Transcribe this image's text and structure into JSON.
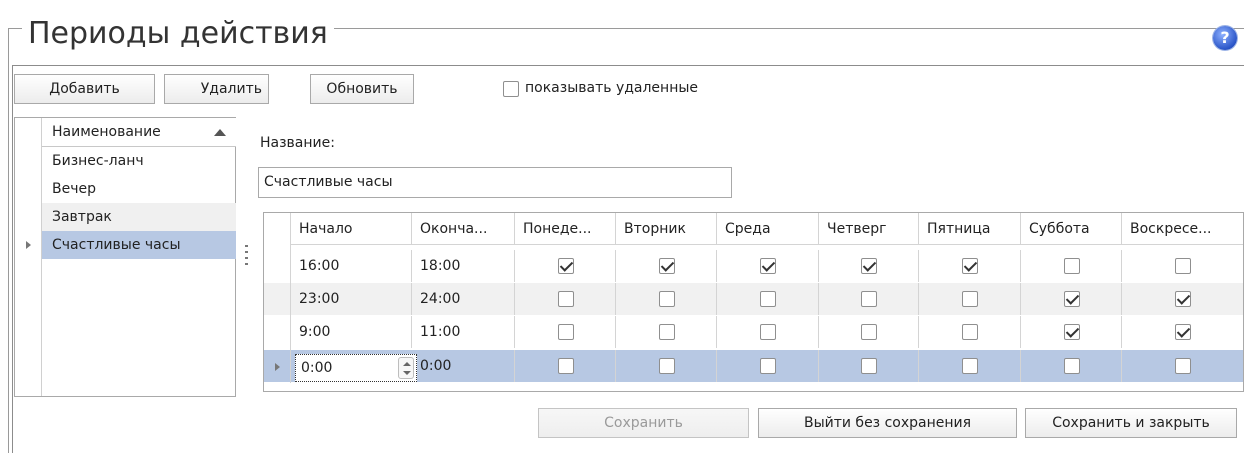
{
  "title": "Периоды действия",
  "help_icon": "help-icon",
  "toolbar": {
    "add_label": "Добавить",
    "delete_label": "Удалить",
    "refresh_label": "Обновить",
    "show_deleted_label": "показывать удаленные",
    "show_deleted_checked": false
  },
  "list": {
    "header": "Наименование",
    "items": [
      {
        "label": "Бизнес-ланч"
      },
      {
        "label": "Вечер"
      },
      {
        "label": "Завтрак"
      },
      {
        "label": "Счастливые часы"
      }
    ],
    "selected_index": 3
  },
  "form": {
    "name_label": "Название:",
    "name_value": "Счастливые часы"
  },
  "grid": {
    "columns": [
      "Начало",
      "Оконча...",
      "Понеде...",
      "Вторник",
      "Среда",
      "Четверг",
      "Пятница",
      "Суббота",
      "Воскресе..."
    ],
    "rows": [
      {
        "start": "16:00",
        "end": "18:00",
        "days": [
          true,
          true,
          true,
          true,
          true,
          false,
          false
        ]
      },
      {
        "start": "23:00",
        "end": "24:00",
        "days": [
          false,
          false,
          false,
          false,
          false,
          true,
          true
        ]
      },
      {
        "start": "9:00",
        "end": "11:00",
        "days": [
          false,
          false,
          false,
          false,
          false,
          true,
          true
        ]
      },
      {
        "start": "0:00",
        "end": "0:00",
        "days": [
          false,
          false,
          false,
          false,
          false,
          false,
          false
        ]
      }
    ],
    "selected_row": 3
  },
  "footer": {
    "save_label": "Сохранить",
    "exit_label": "Выйти без сохранения",
    "save_close_label": "Сохранить и закрыть"
  },
  "colors": {
    "selection": "#b7c8e3",
    "alt_row": "#f0f0f0"
  }
}
